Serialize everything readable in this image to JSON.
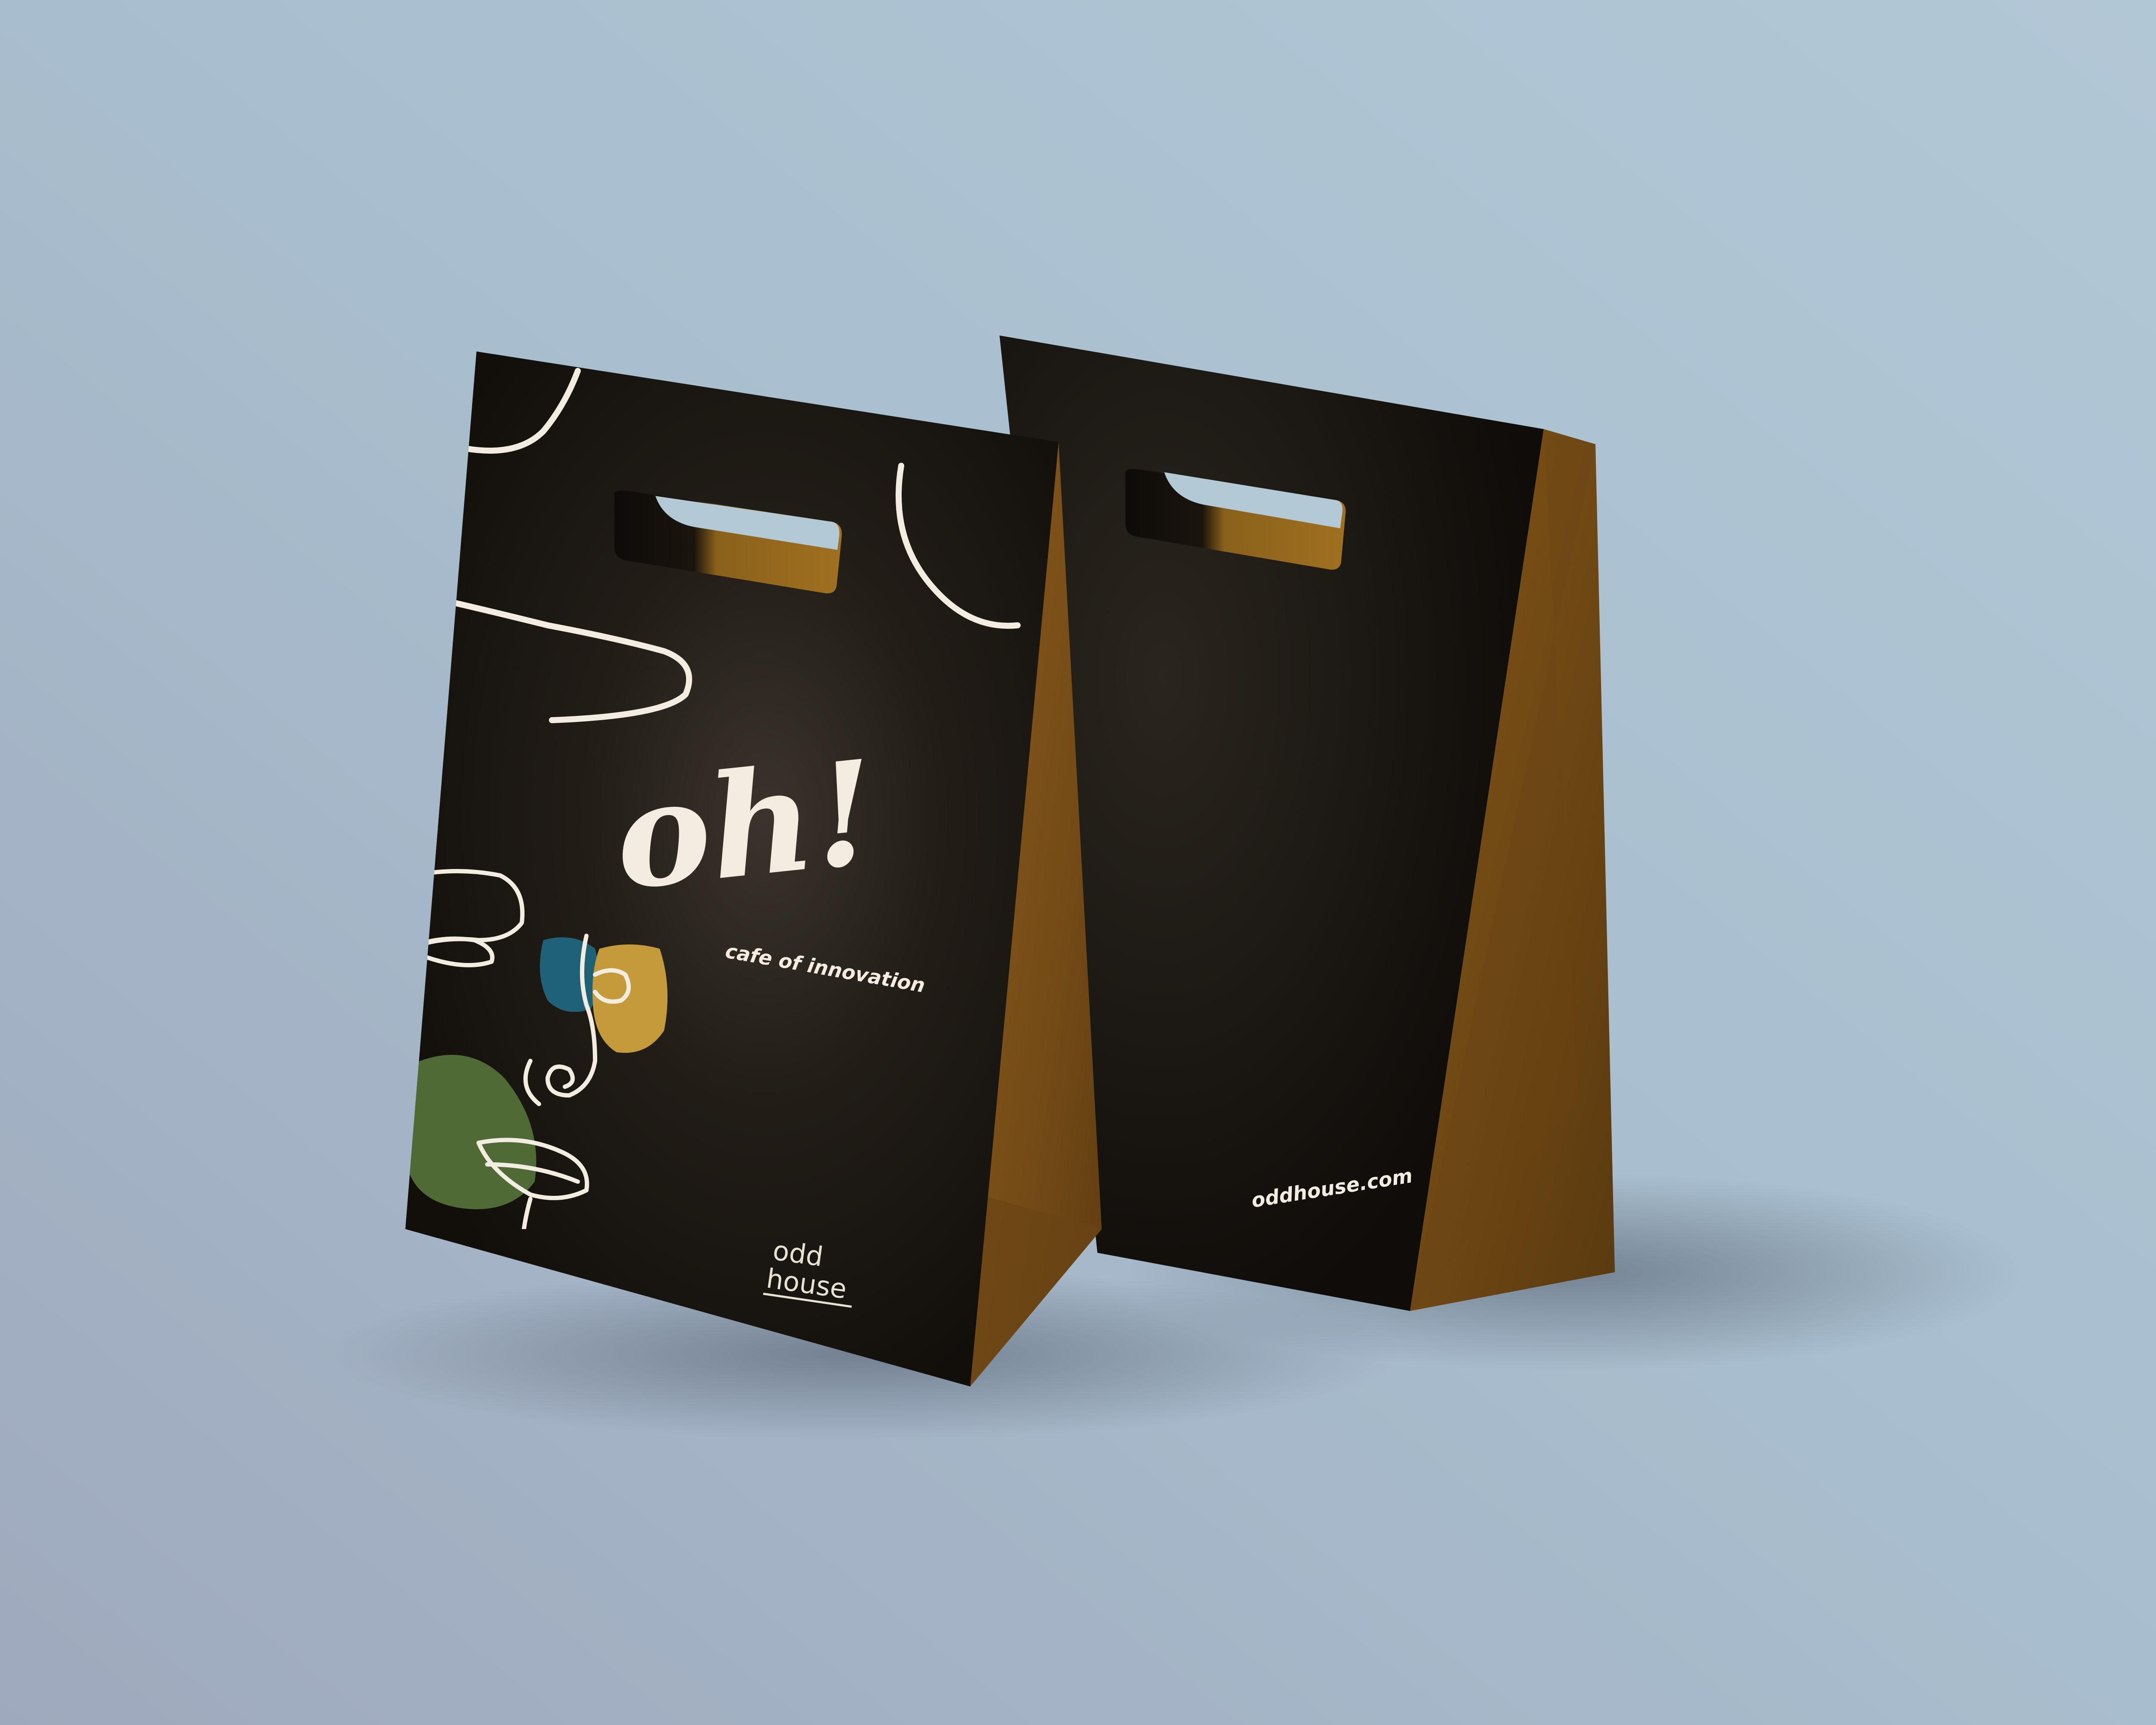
{
  "scene": {
    "background_color": "#a9bfcf",
    "background_shade": "#9fa9bd"
  },
  "front_bag": {
    "headline": "oh!",
    "tagline": "cafe of innovation",
    "logo": {
      "line1": "odd",
      "line2": "house"
    },
    "panel_color": "#1b1712",
    "kraft_color": "#7c5118",
    "accent_colors": {
      "teal": "#1f6278",
      "mustard": "#c59a3b",
      "green": "#4f6a34",
      "line_art": "#f2ede0"
    }
  },
  "back_bag": {
    "url": "oddhouse.com",
    "panel_color": "#15120e",
    "kraft_color": "#7c5118"
  }
}
